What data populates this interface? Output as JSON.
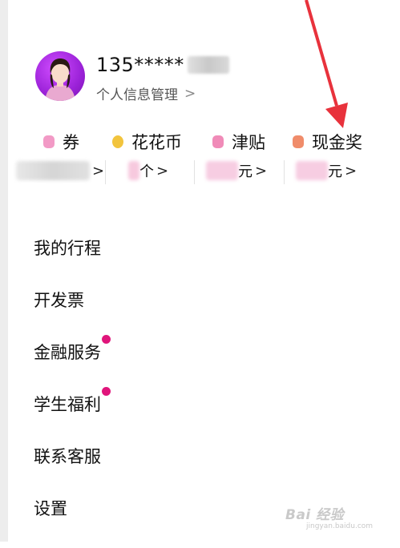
{
  "profile": {
    "phone_prefix": "135*****",
    "info_link": "个人信息管理",
    "chevron": ">"
  },
  "wallet": [
    {
      "label": "券",
      "value": "",
      "icon": "coupon-icon",
      "color": "#f29ac6"
    },
    {
      "label": "花花币",
      "value": "个",
      "icon": "coin-icon",
      "color": "#f2c43d"
    },
    {
      "label": "津贴",
      "value": "元",
      "icon": "allowance-icon",
      "color": "#f08bb8"
    },
    {
      "label": "现金奖",
      "value": "元",
      "icon": "cash-reward-icon",
      "color": "#f08c6a"
    }
  ],
  "menu": [
    {
      "label": "我的行程",
      "badge": false
    },
    {
      "label": "开发票",
      "badge": false
    },
    {
      "label": "金融服务",
      "badge": true
    },
    {
      "label": "学生福利",
      "badge": true
    },
    {
      "label": "联系客服",
      "badge": false
    },
    {
      "label": "设置",
      "badge": false
    }
  ],
  "watermark": {
    "main": "Bai 经验",
    "sub": "jingyan.baidu.com"
  },
  "colors": {
    "accent_red": "#e8323c",
    "badge_pink": "#e0157b",
    "avatar_purple": "#9b22d8"
  }
}
